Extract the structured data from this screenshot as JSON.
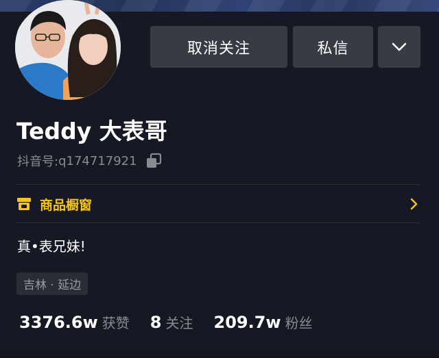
{
  "profile": {
    "username": "Teddy 大表哥",
    "douyin_id_label": "抖音号:",
    "douyin_id_value": "q174717921",
    "bio": "真•表兄妹!",
    "location": "吉林 · 延边"
  },
  "actions": {
    "unfollow_label": "取消关注",
    "message_label": "私信"
  },
  "shop": {
    "label": "商品橱窗"
  },
  "stats": {
    "likes_value": "3376.6w",
    "likes_label": "获赞",
    "following_value": "8",
    "following_label": "关注",
    "followers_value": "209.7w",
    "followers_label": "粉丝"
  },
  "icons": {
    "copy": "copy-icon",
    "shop": "shop-icon",
    "chevron_right": "chevron-right-icon",
    "chevron_down": "chevron-down-icon"
  },
  "colors": {
    "background": "#161823",
    "button": "#393b44",
    "shop_accent": "#f5c518",
    "secondary_text": "#8a8b91"
  }
}
